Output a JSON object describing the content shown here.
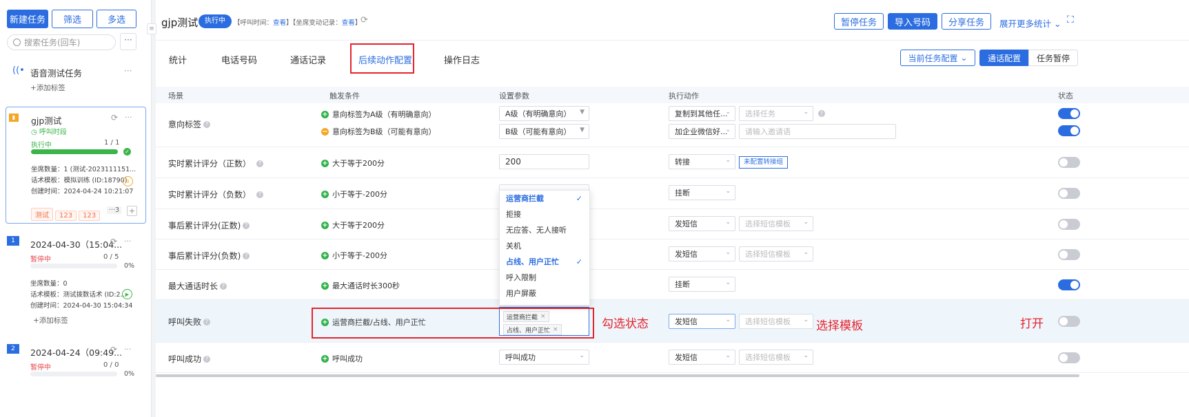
{
  "sidebar": {
    "new_task": "新建任务",
    "filter": "筛选",
    "multi": "多选",
    "search_placeholder": "搜索任务(回车)",
    "more": "···",
    "voice_task": {
      "title": "语音测试任务",
      "add_tag": "+添加标签"
    },
    "card1": {
      "title": "gjp测试",
      "subtitle": "呼叫时段",
      "status": "执行中",
      "count": "1 / 1",
      "progress": 1.0,
      "l1": "坐席数量：1 (测试-2023111151...",
      "l2": "话术模板：模拟训练 (ID:18790)",
      "l3": "创建时间：2024-04-24 10:21:07",
      "tags": [
        "测试",
        "123",
        "123"
      ],
      "extra": "···3"
    },
    "card2": {
      "num": "1",
      "title": "2024-04-30（15:04...",
      "status": "暂停中",
      "count": "0 / 5",
      "pct": "0%",
      "progress": 0,
      "l1": "坐席数量：0",
      "l2": "话术模板：测试拨数话术 (ID:2...",
      "l3": "创建时间：2024-04-30 15:04:34",
      "add_tag": "+添加标签"
    },
    "card3": {
      "num": "2",
      "title": "2024-04-24（09:49...",
      "status": "暂停中",
      "count": "0 / 0",
      "pct": "0%",
      "progress": 0
    }
  },
  "header": {
    "title": "gjp测试",
    "badge": "执行中",
    "meta": "【呼叫时间：",
    "meta_link1": "查看",
    "meta2": "】【坐席变动记录：",
    "meta_link2": "查看",
    "meta3": "】",
    "pause": "暂停任务",
    "import": "导入号码",
    "share": "分享任务",
    "expand": "展开更多统计"
  },
  "tabs": [
    "统计",
    "电话号码",
    "通话记录",
    "后续动作配置",
    "操作日志"
  ],
  "right_tabs": {
    "current": "当前任务配置",
    "call_cfg": "通话配置",
    "pause_cfg": "任务暂停"
  },
  "columns": [
    "场景",
    "触发条件",
    "设置参数",
    "执行动作",
    "状态"
  ],
  "rows": [
    {
      "scene": "意向标签",
      "c1": "意向标签为A级（有明确意向）",
      "c2": "意向标签为B级（可能有意向）",
      "p1": "A级（有明确意向）",
      "p2": "B级（可能有意向）",
      "a1": "复制到其他任...",
      "a1b": "选择任务",
      "a2": "加企业微信好...",
      "a2b": "请输入邀请语"
    },
    {
      "scene": "实时累计评分（正数）",
      "c1": "大于等于200分",
      "p1": "200",
      "a1": "转接",
      "a1b": "未配置转接组"
    },
    {
      "scene": "实时累计评分（负数）",
      "c1": "小于等于-200分",
      "a1": "挂断"
    },
    {
      "scene": "事后累计评分(正数)",
      "c1": "大于等于200分",
      "a1": "发短信",
      "a1b": "选择短信模板"
    },
    {
      "scene": "事后累计评分(负数)",
      "c1": "小于等于-200分",
      "a1": "发短信",
      "a1b": "选择短信模板"
    },
    {
      "scene": "最大通话时长",
      "c1": "最大通话时长300秒",
      "a1": "挂断"
    },
    {
      "scene": "呼叫失败",
      "c1": "运营商拦截/占线、用户正忙",
      "tags": [
        "运营商拦截",
        "占线、用户正忙"
      ],
      "a1": "发短信",
      "a1b": "选择短信模板"
    },
    {
      "scene": "呼叫成功",
      "c1": "呼叫成功",
      "p1": "呼叫成功",
      "a1": "发短信",
      "a1b": "选择短信模板"
    }
  ],
  "dropdown": [
    {
      "label": "运营商拦截",
      "selected": true
    },
    {
      "label": "拒接",
      "selected": false
    },
    {
      "label": "无应答、无人接听",
      "selected": false
    },
    {
      "label": "关机",
      "selected": false
    },
    {
      "label": "占线、用户正忙",
      "selected": true
    },
    {
      "label": "呼入限制",
      "selected": false
    },
    {
      "label": "用户屏蔽",
      "selected": false
    }
  ],
  "annotations": {
    "check": "勾选状态",
    "template": "选择模板",
    "open": "打开"
  },
  "toggles": [
    true,
    false,
    false,
    false,
    false,
    true,
    false,
    false
  ],
  "toggle_row1b": true
}
